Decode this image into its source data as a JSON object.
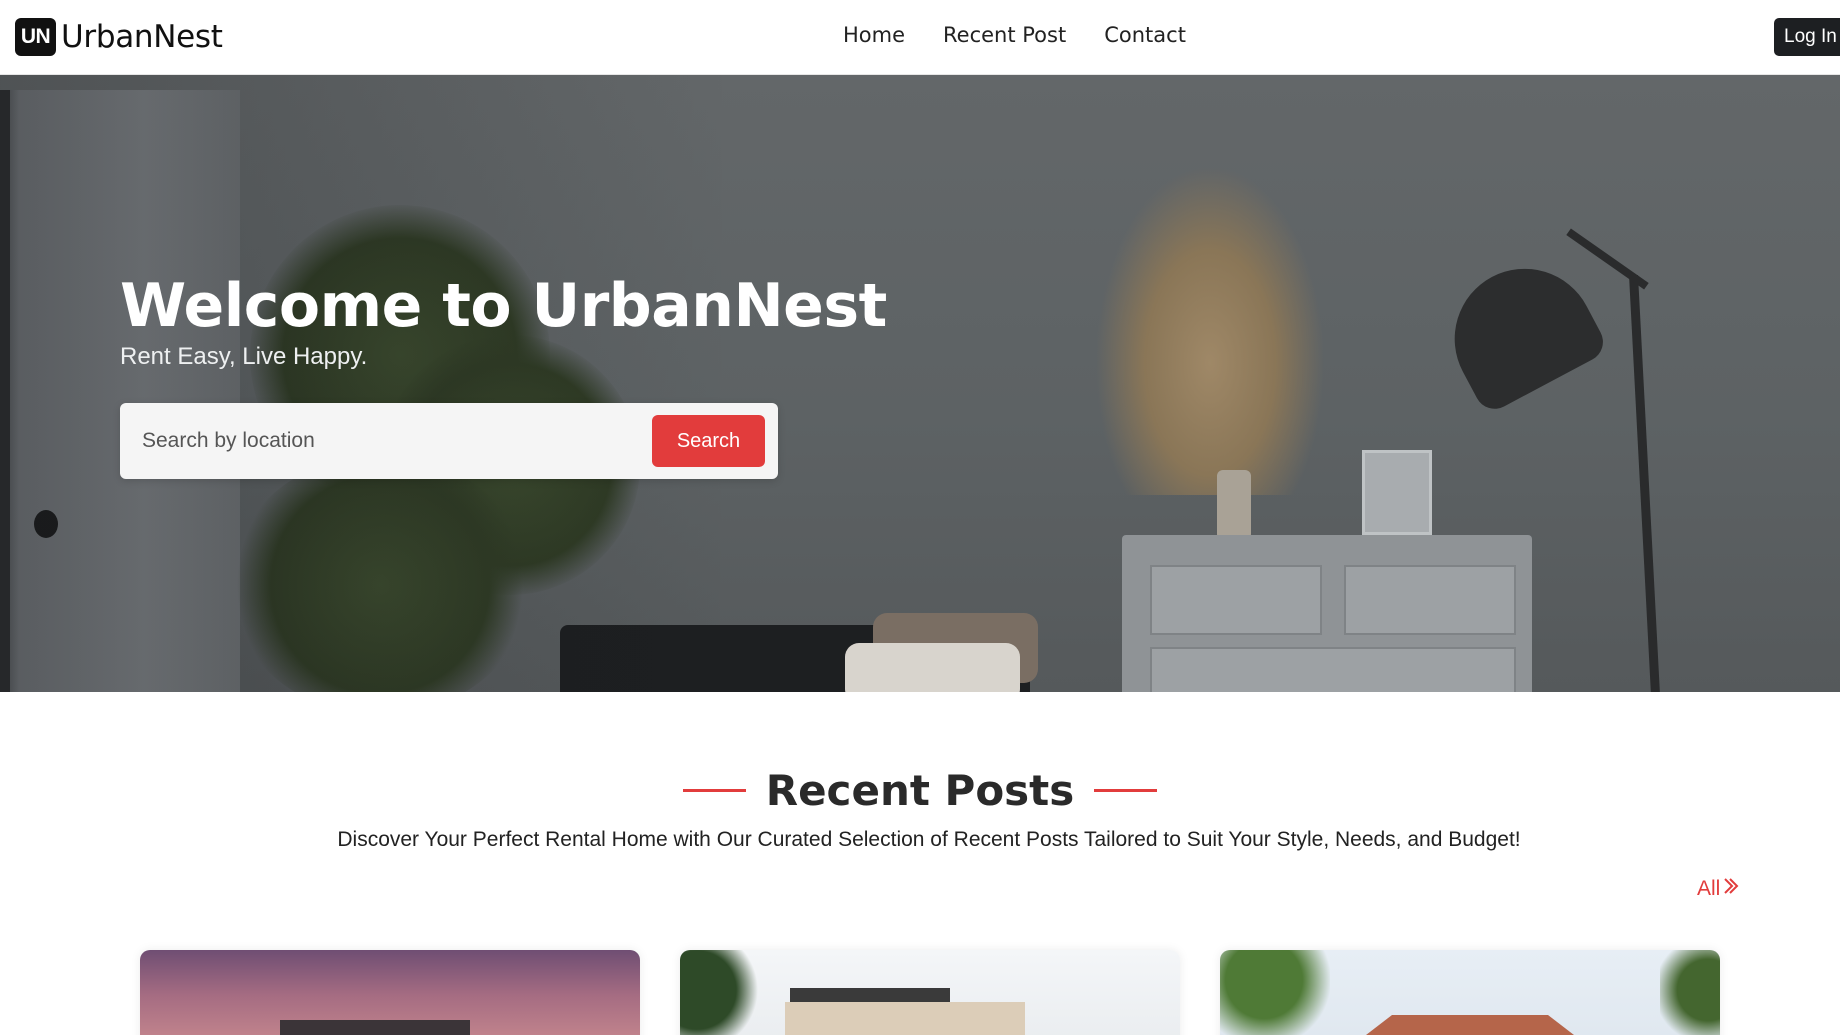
{
  "brand": {
    "badge": "UN",
    "name": "UrbanNest"
  },
  "nav": {
    "links": [
      "Home",
      "Recent Post",
      "Contact"
    ],
    "login_label": "Log In"
  },
  "hero": {
    "title": "Welcome to UrbanNest",
    "subtitle": "Rent Easy, Live Happy.",
    "search_placeholder": "Search by location",
    "search_button": "Search"
  },
  "recent": {
    "title": "Recent Posts",
    "description": "Discover Your Perfect Rental Home with Our Curated Selection of Recent Posts Tailored to Suit Your Style, Needs, and Budget!",
    "all_link": "All"
  },
  "colors": {
    "accent": "#e23c3c",
    "dark": "#1d1f22"
  },
  "icons": {
    "all_link_icon": "double-chevron-right-icon"
  }
}
